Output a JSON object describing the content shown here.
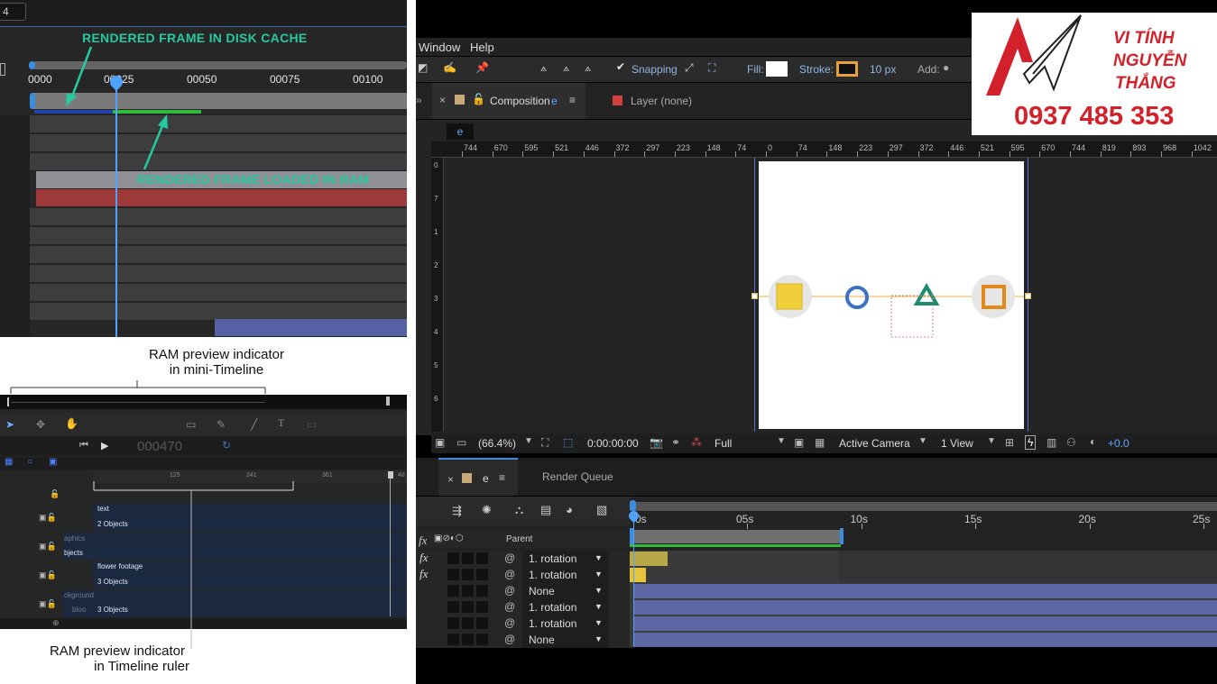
{
  "left_top": {
    "timecode": "4",
    "ruler_ticks": [
      "0000",
      "00025",
      "00050",
      "00075",
      "00100"
    ],
    "annotation_disk": "RENDERED FRAME IN DISK CACHE",
    "annotation_ram": "RENDERED FRAME LOADED IN RAM"
  },
  "captions": {
    "mini_timeline_line1": "RAM preview indicator",
    "mini_timeline_line2": "in mini-Timeline",
    "ruler_line1": "RAM preview indicator",
    "ruler_line2": "in Timeline ruler"
  },
  "left_bottom": {
    "timecode": "000470",
    "ruler_ticks": [
      "125",
      "241",
      "361",
      "48"
    ],
    "tracks": [
      {
        "title": "text",
        "count": "2 Objects"
      },
      {
        "title": "aphics",
        "count": "bjects"
      },
      {
        "title": "flower footage",
        "count": "3 Objects"
      },
      {
        "title": "ckground",
        "count": "3 Objects"
      }
    ],
    "bloo_label": "bloo"
  },
  "right": {
    "menu": [
      "Window",
      "Help"
    ],
    "toolbar": {
      "snapping": "Snapping",
      "fill": "Fill:",
      "stroke": "Stroke:",
      "stroke_px": "10 px",
      "add": "Add:"
    },
    "tabs": {
      "composition": "Composition",
      "composition_name": "e",
      "layer": "Layer (none)",
      "comp_tab_name": "e"
    },
    "ruler_labels": [
      "744",
      "670",
      "595",
      "521",
      "446",
      "372",
      "297",
      "223",
      "148",
      "74",
      "0",
      "74",
      "148",
      "223",
      "297",
      "372",
      "446",
      "521",
      "595",
      "670",
      "744",
      "819",
      "893",
      "968",
      "1042",
      "1117"
    ],
    "vruler_labels": [
      "0",
      "7",
      "1",
      "2",
      "3",
      "4",
      "5",
      "6"
    ],
    "status": {
      "zoom": "(66.4%)",
      "time": "0:00:00:00",
      "resolution": "Full",
      "camera": "Active Camera",
      "views": "1 View",
      "exposure": "+0.0"
    },
    "timeline": {
      "tab": "e",
      "render_queue": "Render Queue",
      "parent_header": "Parent",
      "ruler": [
        "0s",
        "05s",
        "10s",
        "15s",
        "20s",
        "25s"
      ],
      "rows": [
        {
          "parent": "1. rotation",
          "fx": "fx"
        },
        {
          "parent": "1. rotation",
          "fx": "fx"
        },
        {
          "parent": "None",
          "fx": ""
        },
        {
          "parent": "1. rotation",
          "fx": ""
        },
        {
          "parent": "1. rotation",
          "fx": ""
        },
        {
          "parent": "None",
          "fx": ""
        }
      ]
    },
    "logo": {
      "line1": "VI TÍNH",
      "line2": "NGUYỄN",
      "line3": "THẮNG",
      "phone": "0937 485 353"
    },
    "colors": {
      "accent": "#2d8cf0",
      "green": "#27c9a0",
      "logo_red": "#d3212b",
      "layer_blue": "#5b66a3"
    }
  }
}
